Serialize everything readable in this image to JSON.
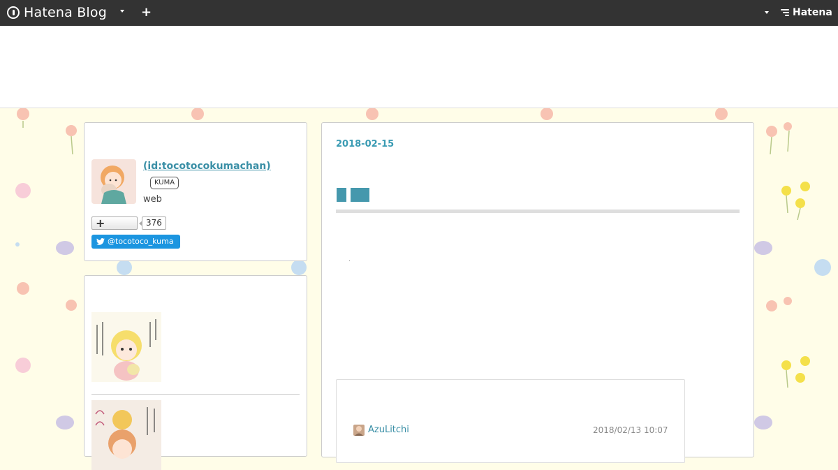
{
  "topbar": {
    "brand_name": "Hatena Blog",
    "plus_symbol": "+",
    "hatena_label": "Hatena",
    "background": "#333333"
  },
  "profile": {
    "id_link": " (id:tocotocokumachan)",
    "badge": "KUMA",
    "description": "web",
    "follow_count": "376",
    "twitter_handle": "@tocotoco_kuma",
    "link_color": "#3a8fa6",
    "twitter_color": "#1b95e0"
  },
  "entry": {
    "date": "2018-02-15",
    "accent_color": "#3a9bb3"
  },
  "comment": {
    "user": "AzuLitchi",
    "timestamp": "2018/02/13 10:07"
  },
  "icons": {
    "brand": "hatena-blog-icon",
    "add": "plus-icon",
    "menu": "chevron-down-icon",
    "follow": "plus-icon",
    "twitter": "twitter-bird-icon"
  }
}
